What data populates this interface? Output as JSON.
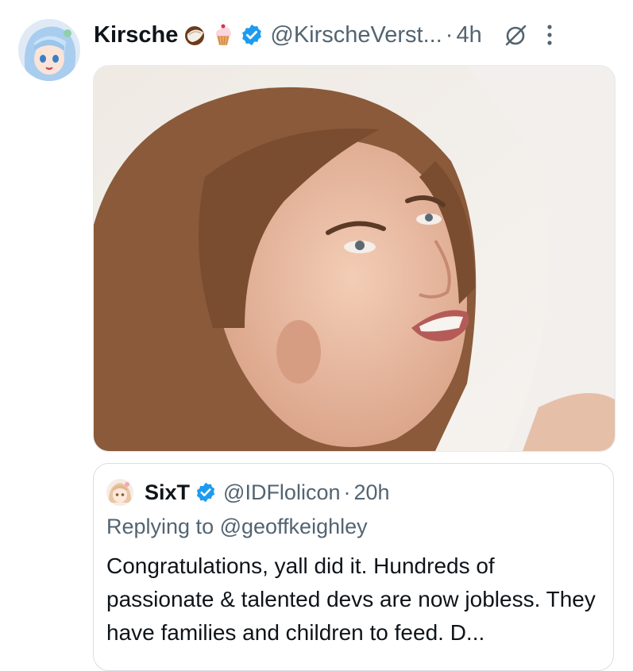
{
  "tweet": {
    "author_name": "Kirsche",
    "handle": "@KirscheVerst...",
    "separator": "·",
    "time": "4h",
    "emojis": [
      "coconut-icon",
      "cupcake-icon"
    ],
    "verified": true
  },
  "quote": {
    "author_name": "SixT",
    "handle": "@IDFlolicon",
    "separator": "·",
    "time": "20h",
    "replying_to": "Replying to @geoffkeighley",
    "text": "Congratulations, yall did it. Hundreds of passionate & talented devs are now jobless. They have families and children to feed. D..."
  },
  "colors": {
    "verified_blue": "#1d9bf0",
    "secondary_text": "#536471",
    "primary_text": "#0f1419"
  }
}
